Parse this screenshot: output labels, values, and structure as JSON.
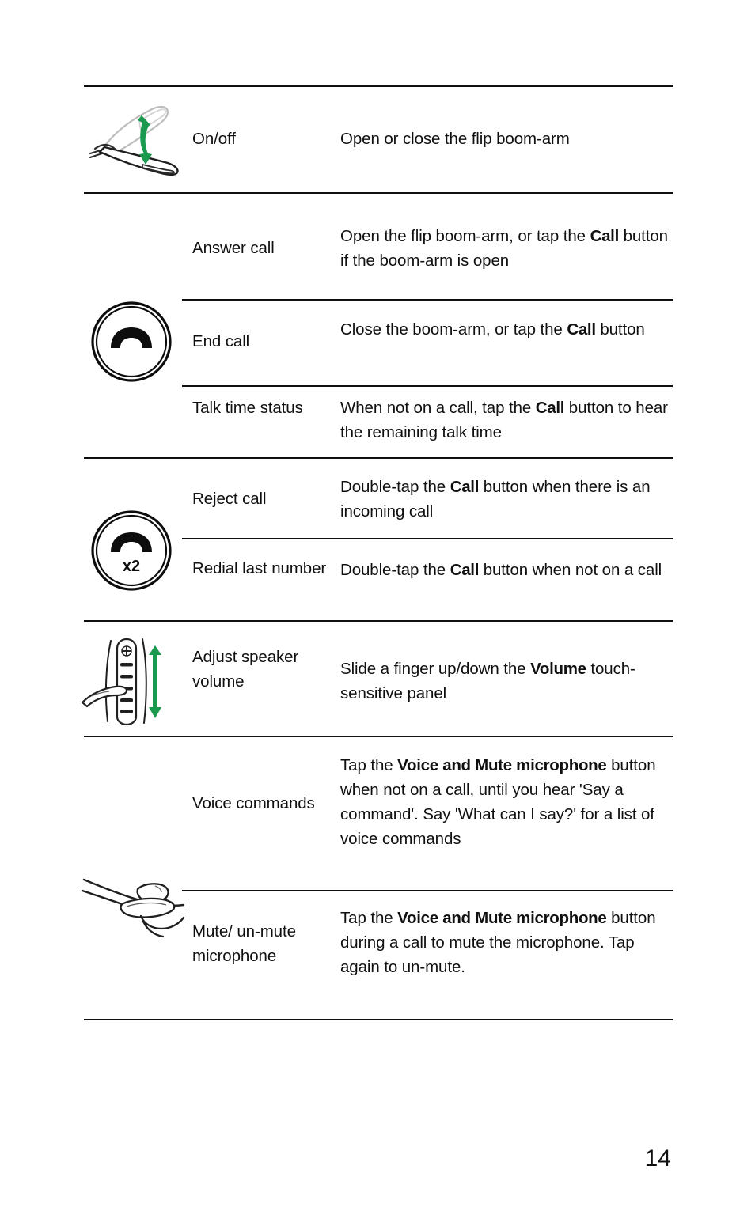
{
  "document": {
    "page_number": "14",
    "accent_green": "#1a9a4e",
    "ink": "#101010"
  },
  "rows": [
    {
      "icon": "headset-flip-boom-arm-icon",
      "action": "On/off",
      "description_parts": [
        {
          "text": "Open or close the flip boom-arm",
          "bold": false
        }
      ],
      "description_plain": "Open or close the flip boom-arm"
    },
    {
      "icon": "phone-handset-circle-icon",
      "action": "Answer call",
      "description_parts": [
        {
          "text": "Open the flip boom-arm, or tap the ",
          "bold": false
        },
        {
          "text": "Call",
          "bold": true
        },
        {
          "text": " button if the boom-arm is open",
          "bold": false
        }
      ],
      "description_plain": "Open the flip boom-arm, or tap the Call button if the boom-arm is open"
    },
    {
      "icon": "phone-handset-circle-icon",
      "action": "End call",
      "description_parts": [
        {
          "text": "Close the boom-arm, or tap the ",
          "bold": false
        },
        {
          "text": "Call",
          "bold": true
        },
        {
          "text": " button",
          "bold": false
        }
      ],
      "description_plain": "Close the boom-arm, or tap the Call button"
    },
    {
      "icon": "phone-handset-circle-icon",
      "action": "Talk time status",
      "description_parts": [
        {
          "text": "When not on a call, tap the ",
          "bold": false
        },
        {
          "text": "Call",
          "bold": true
        },
        {
          "text": " button to hear the remaining talk time",
          "bold": false
        }
      ],
      "description_plain": "When not on a call, tap the Call button to hear the remaining talk time"
    },
    {
      "icon": "phone-handset-double-tap-circle-icon",
      "action": "Reject call",
      "description_parts": [
        {
          "text": "Double-tap the ",
          "bold": false
        },
        {
          "text": "Call",
          "bold": true
        },
        {
          "text": " button when there is an incoming call",
          "bold": false
        }
      ],
      "description_plain": "Double-tap the Call button when there is an incoming call"
    },
    {
      "icon": "phone-handset-double-tap-circle-icon",
      "action": "Redial last number",
      "description_parts": [
        {
          "text": "Double-tap the ",
          "bold": false
        },
        {
          "text": "Call",
          "bold": true
        },
        {
          "text": " button when not on a call",
          "bold": false
        }
      ],
      "description_plain": "Double-tap the Call button when not on a call"
    },
    {
      "icon": "finger-slide-volume-panel-icon",
      "action": "Adjust speaker volume",
      "description_parts": [
        {
          "text": "Slide a finger up/down the ",
          "bold": false
        },
        {
          "text": "Volume",
          "bold": true
        },
        {
          "text": " touch-sensitive panel",
          "bold": false
        }
      ],
      "description_plain": "Slide a finger up/down the Volume touch-sensitive panel"
    },
    {
      "icon": "finger-tap-button-icon",
      "action": "Voice commands",
      "description_parts": [
        {
          "text": "Tap the ",
          "bold": false
        },
        {
          "text": "Voice and Mute microphone",
          "bold": true
        },
        {
          "text": " button when not on a call, until you hear 'Say a command'. Say 'What can I say?' for a list of voice commands",
          "bold": false
        }
      ],
      "description_plain": "Tap the Voice and Mute microphone button when not on a call, until you hear 'Say a command'. Say 'What can I say?' for a list of voice commands"
    },
    {
      "icon": "finger-tap-button-icon",
      "action": "Mute/ un-mute microphone",
      "description_parts": [
        {
          "text": "Tap the ",
          "bold": false
        },
        {
          "text": "Voice and Mute microphone",
          "bold": true
        },
        {
          "text": " button during a call to mute the microphone. Tap again to un-mute.",
          "bold": false
        }
      ],
      "description_plain": "Tap the Voice and Mute microphone button during a call to mute the microphone. Tap again to un-mute."
    }
  ],
  "icon_labels": {
    "double_tap_badge": "x2",
    "volume_plus": "+"
  }
}
